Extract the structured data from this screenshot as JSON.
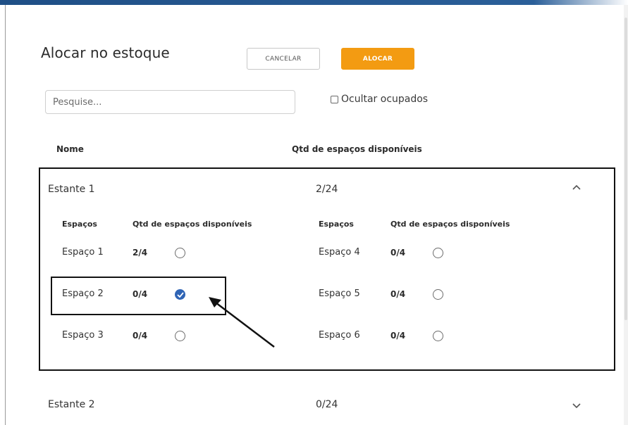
{
  "title": "Alocar no estoque",
  "actions": {
    "cancel_label": "CANCELAR",
    "alocar_label": "ALOCAR"
  },
  "colors": {
    "accent": "#f39b12",
    "selected": "#2f64b5",
    "header_bar": "#2b5f99"
  },
  "search": {
    "placeholder": "Pesquise...",
    "value": ""
  },
  "filter": {
    "hide_occupied_label": "Ocultar ocupados",
    "checked": false
  },
  "table": {
    "headers": {
      "name": "Nome",
      "qty": "Qtd de espaços disponíveis"
    },
    "shelves": [
      {
        "name": "Estante 1",
        "qty": "2/24",
        "expanded": true,
        "sub_headers": {
          "spaces": "Espaços",
          "qty": "Qtd de espaços disponíveis"
        },
        "spaces": [
          {
            "name": "Espaço 1",
            "qty": "2/4",
            "selected": false
          },
          {
            "name": "Espaço 2",
            "qty": "0/4",
            "selected": true
          },
          {
            "name": "Espaço 3",
            "qty": "0/4",
            "selected": false
          },
          {
            "name": "Espaço 4",
            "qty": "0/4",
            "selected": false
          },
          {
            "name": "Espaço 5",
            "qty": "0/4",
            "selected": false
          },
          {
            "name": "Espaço 6",
            "qty": "0/4",
            "selected": false
          }
        ]
      },
      {
        "name": "Estante 2",
        "qty": "0/24",
        "expanded": false
      }
    ]
  },
  "icons": {
    "collapse": "chevron-up-icon",
    "expand": "chevron-down-icon",
    "checked": "check-icon",
    "annotation": "arrow-icon"
  }
}
